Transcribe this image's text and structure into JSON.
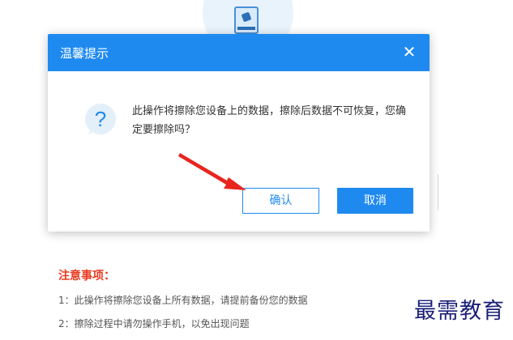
{
  "background": {
    "notes_title": "注意事项：",
    "notes": [
      "1：此操作将擦除您设备上所有数据，请提前备份您的数据",
      "2：擦除过程中请勿操作手机，以免出现问题"
    ],
    "watermark": "最需教育"
  },
  "dialog": {
    "title": "温馨提示",
    "close_label": "✕",
    "message": "此操作将擦除您设备上的数据，擦除后数据不可恢复，您确定要擦除吗？",
    "icon": "question-icon",
    "confirm_label": "确认",
    "cancel_label": "取消"
  },
  "colors": {
    "primary": "#1e8af0",
    "warning": "#e8391f",
    "arrow": "#e8251f"
  }
}
